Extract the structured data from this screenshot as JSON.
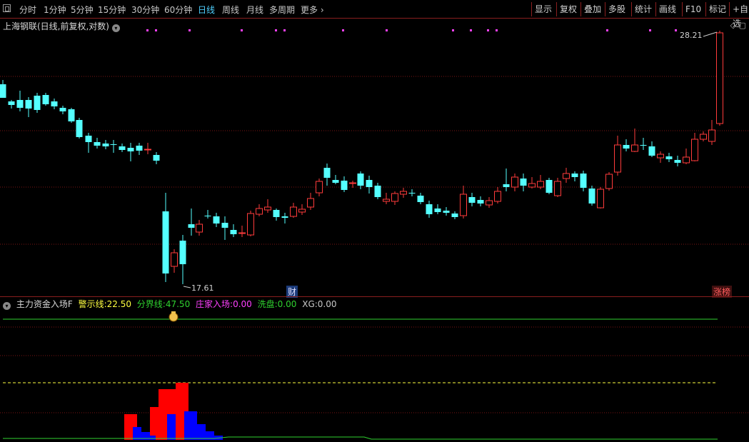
{
  "toolbar": {
    "periods": [
      "分时",
      "1分钟",
      "5分钟",
      "15分钟",
      "30分钟",
      "60分钟",
      "日线",
      "周线",
      "月线",
      "多周期",
      "更多"
    ],
    "active_period": "日线",
    "right_buttons": [
      "显示",
      "复权",
      "叠加",
      "多股",
      "统计",
      "画线",
      "F10",
      "标记",
      "+自选"
    ]
  },
  "chart": {
    "title": "上海钢联(日线,前复权,对数)",
    "high_label": "28.21",
    "low_label": "17.61",
    "tag_finance": "财",
    "tag_limit": "涨榜"
  },
  "indicator": {
    "name": "主力资金入场F",
    "warn_label": "警示线:",
    "warn_value": "22.50",
    "split_label": "分界线:",
    "split_value": "47.50",
    "dealer_label": "庄家入场:",
    "dealer_value": "0.00",
    "wash_label": "洗盘:",
    "wash_value": "0.00",
    "xg_label": "XG:",
    "xg_value": "0.00"
  },
  "colors": {
    "up": "#ff3b3b",
    "down": "#54ffff",
    "grid": "#7a1515",
    "magenta": "#ff40ff",
    "green_line": "#2fd22f",
    "yellow_dash": "#ffff40",
    "blue_bar": "#0000ff",
    "red_bar": "#ff0000"
  },
  "icons": {
    "window": "window-icon",
    "dropdown": "circle-chevron-icon",
    "money_bag": "money-bag-icon",
    "diamond": "diamond-icon",
    "square": "square-icon"
  }
}
